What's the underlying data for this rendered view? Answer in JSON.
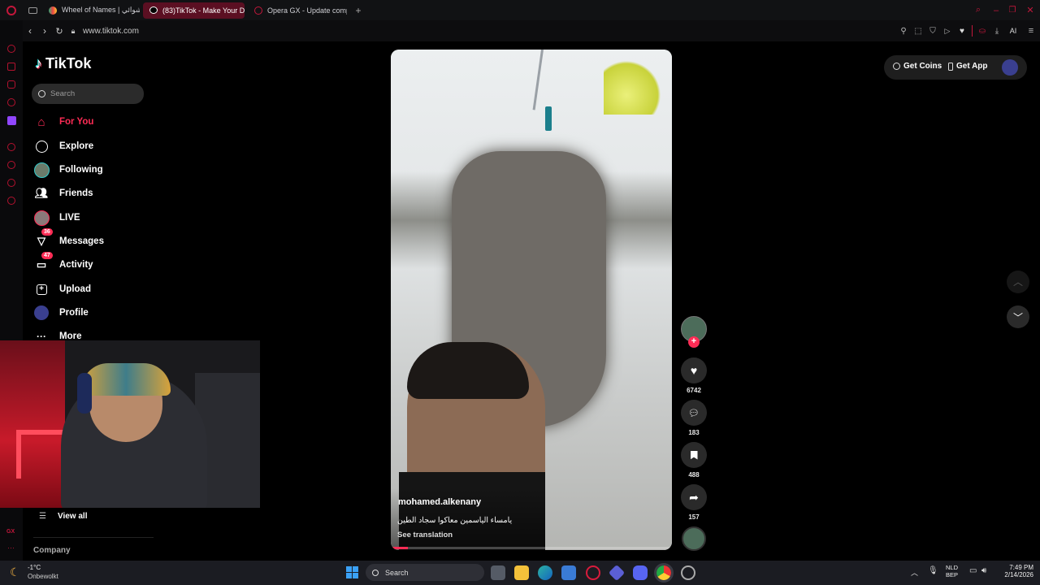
{
  "browser": {
    "tabs": [
      {
        "label": "Wheel of Names | العشوائي",
        "active": false
      },
      {
        "label": "(83)TikTok - Make Your D",
        "active": true
      },
      {
        "label": "Opera GX - Update compl",
        "active": false
      }
    ],
    "address": "www.tiktok.com",
    "ai_label": "AI"
  },
  "tiktok": {
    "logo": "TikTok",
    "search_placeholder": "Search",
    "nav": [
      {
        "label": "For You",
        "icon": "home-icon",
        "active": true
      },
      {
        "label": "Explore",
        "icon": "compass-icon"
      },
      {
        "label": "Following",
        "icon": "following-avatar-icon"
      },
      {
        "label": "Friends",
        "icon": "friends-icon"
      },
      {
        "label": "LIVE",
        "icon": "live-avatar-icon"
      },
      {
        "label": "Messages",
        "icon": "messages-icon",
        "badge": "36"
      },
      {
        "label": "Activity",
        "icon": "activity-icon",
        "badge": "47"
      },
      {
        "label": "Upload",
        "icon": "upload-icon"
      },
      {
        "label": "Profile",
        "icon": "profile-avatar-icon"
      },
      {
        "label": "More",
        "icon": "more-icon"
      }
    ],
    "view_all": "View all",
    "company": "Company",
    "get_coins": "Get Coins",
    "get_app": "Get App",
    "video": {
      "username": "mohamed.alkenany",
      "caption": "يامساء الياسمين معاكوا سجاد الطين",
      "see_translation": "See translation",
      "progress": 0.06
    },
    "actions": {
      "likes": "6742",
      "comments": "183",
      "saves": "488",
      "shares": "157"
    }
  },
  "taskbar": {
    "weather_temp": "-1°C",
    "weather_desc": "Onbewolkt",
    "search": "Search",
    "lang1": "NLD",
    "lang2": "BEP",
    "time": "7:49 PM",
    "date": "2/14/2026"
  },
  "colors": {
    "accent": "#fe2c55",
    "opera_red": "#c3173b"
  }
}
